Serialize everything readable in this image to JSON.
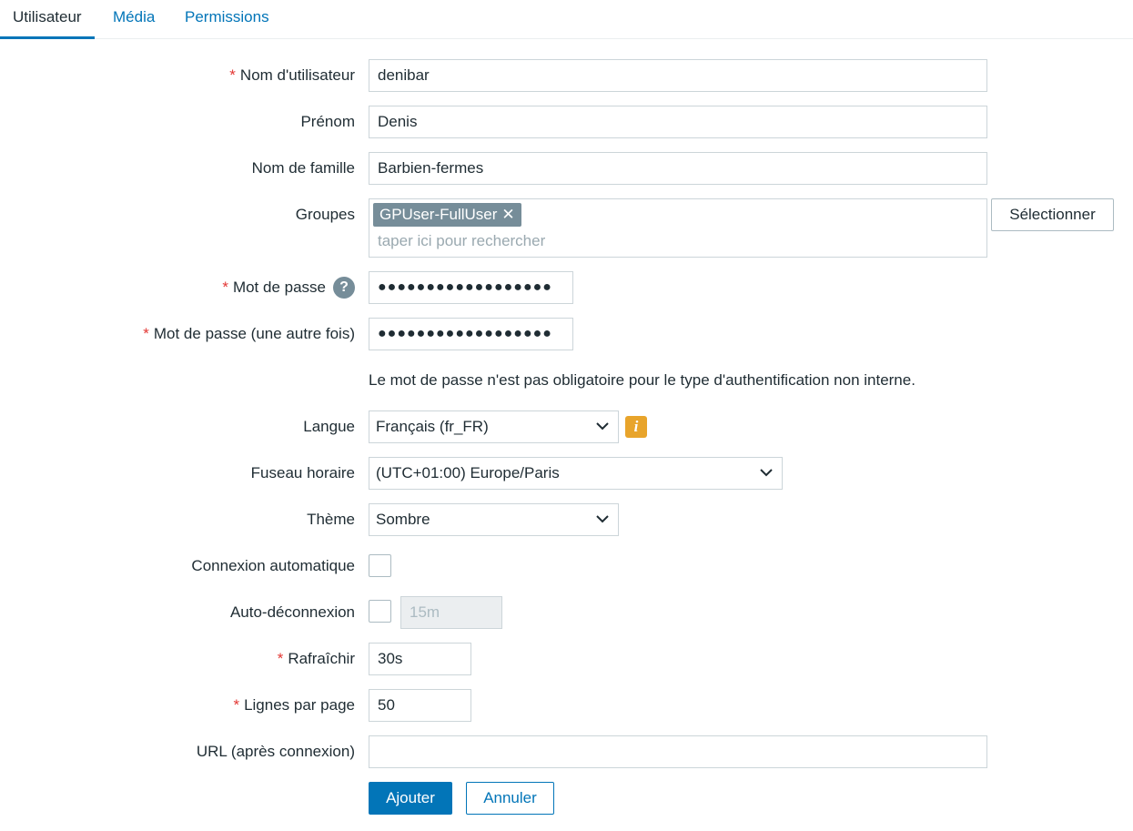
{
  "tabs": [
    {
      "label": "Utilisateur",
      "active": true
    },
    {
      "label": "Média",
      "active": false
    },
    {
      "label": "Permissions",
      "active": false
    }
  ],
  "form": {
    "username": {
      "label": "Nom d'utilisateur",
      "required": true,
      "value": "denibar"
    },
    "first_name": {
      "label": "Prénom",
      "value": "Denis"
    },
    "last_name": {
      "label": "Nom de famille",
      "value": "Barbien-fermes"
    },
    "groups": {
      "label": "Groupes",
      "chips": [
        "GPUser-FullUser"
      ],
      "chip_remove": "✕",
      "placeholder": "taper ici pour rechercher",
      "select_button": "Sélectionner"
    },
    "password": {
      "label": "Mot de passe",
      "required": true,
      "value": "●●●●●●●●●●●●●●●●●●",
      "help": "?"
    },
    "password_confirm": {
      "label": "Mot de passe (une autre fois)",
      "required": true,
      "value": "●●●●●●●●●●●●●●●●●●"
    },
    "password_note": "Le mot de passe n'est pas obligatoire pour le type d'authentification non interne.",
    "language": {
      "label": "Langue",
      "value": "Français (fr_FR)",
      "info": "i"
    },
    "timezone": {
      "label": "Fuseau horaire",
      "value": "(UTC+01:00) Europe/Paris"
    },
    "theme": {
      "label": "Thème",
      "value": "Sombre"
    },
    "autologin": {
      "label": "Connexion automatique",
      "checked": false
    },
    "autologout": {
      "label": "Auto-déconnexion",
      "checked": false,
      "value": "15m"
    },
    "refresh": {
      "label": "Rafraîchir",
      "required": true,
      "value": "30s"
    },
    "rows_per_page": {
      "label": "Lignes par page",
      "required": true,
      "value": "50"
    },
    "url": {
      "label": "URL (après connexion)",
      "value": ""
    }
  },
  "actions": {
    "add": "Ajouter",
    "cancel": "Annuler"
  },
  "required_mark": "*",
  "colors": {
    "accent": "#0275b8",
    "required": "#e33734",
    "chip": "#768d99",
    "info": "#e8a42b"
  }
}
